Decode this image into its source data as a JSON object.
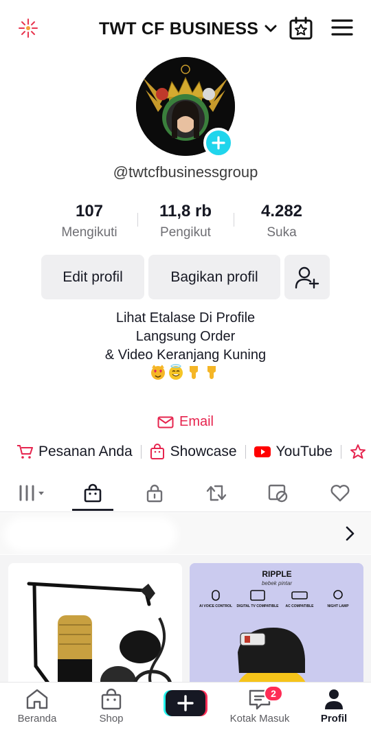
{
  "header": {
    "account_name": "TWT CF BUSINESS",
    "icons": [
      "sparkle-icon",
      "chevron-down-icon",
      "calendar-star-icon",
      "hamburger-menu-icon"
    ]
  },
  "profile": {
    "username": "@twtcfbusinessgroup",
    "stats": [
      {
        "value": "107",
        "label": "Mengikuti"
      },
      {
        "value": "11,8 rb",
        "label": "Pengikut"
      },
      {
        "value": "4.282",
        "label": "Suka"
      }
    ]
  },
  "actions": {
    "edit_label": "Edit profil",
    "share_label": "Bagikan profil"
  },
  "bio": {
    "line1": "Lihat Etalase Di Profile",
    "line2": "Langsung Order",
    "line3": "& Video Keranjang Kuning"
  },
  "contact": {
    "email_label": "Email"
  },
  "links": [
    {
      "label": "Pesanan Anda"
    },
    {
      "label": "Showcase"
    },
    {
      "label": "YouTube"
    }
  ],
  "colors": {
    "accent": "#fe2c55",
    "email": "#e6244e",
    "badge_blue": "#20d5ec",
    "youtube": "#ff0000"
  },
  "tabs": [
    "grid-icon",
    "shopping-bag-icon",
    "lock-icon",
    "repost-icon",
    "tagged-icon",
    "heart-icon"
  ],
  "products": [
    {
      "brand": ""
    },
    {
      "brand": "RIPPLE",
      "subbrand": "bebek pintar",
      "features": [
        "AI VOICE CONTROL",
        "DIGITAL TV COMPATIBLE",
        "AC COMPATIBLE",
        "NIGHT LAMP"
      ]
    }
  ],
  "bottom_nav": [
    {
      "label": "Beranda"
    },
    {
      "label": "Shop"
    },
    {
      "label": ""
    },
    {
      "label": "Kotak Masuk",
      "badge": "2"
    },
    {
      "label": "Profil"
    }
  ]
}
